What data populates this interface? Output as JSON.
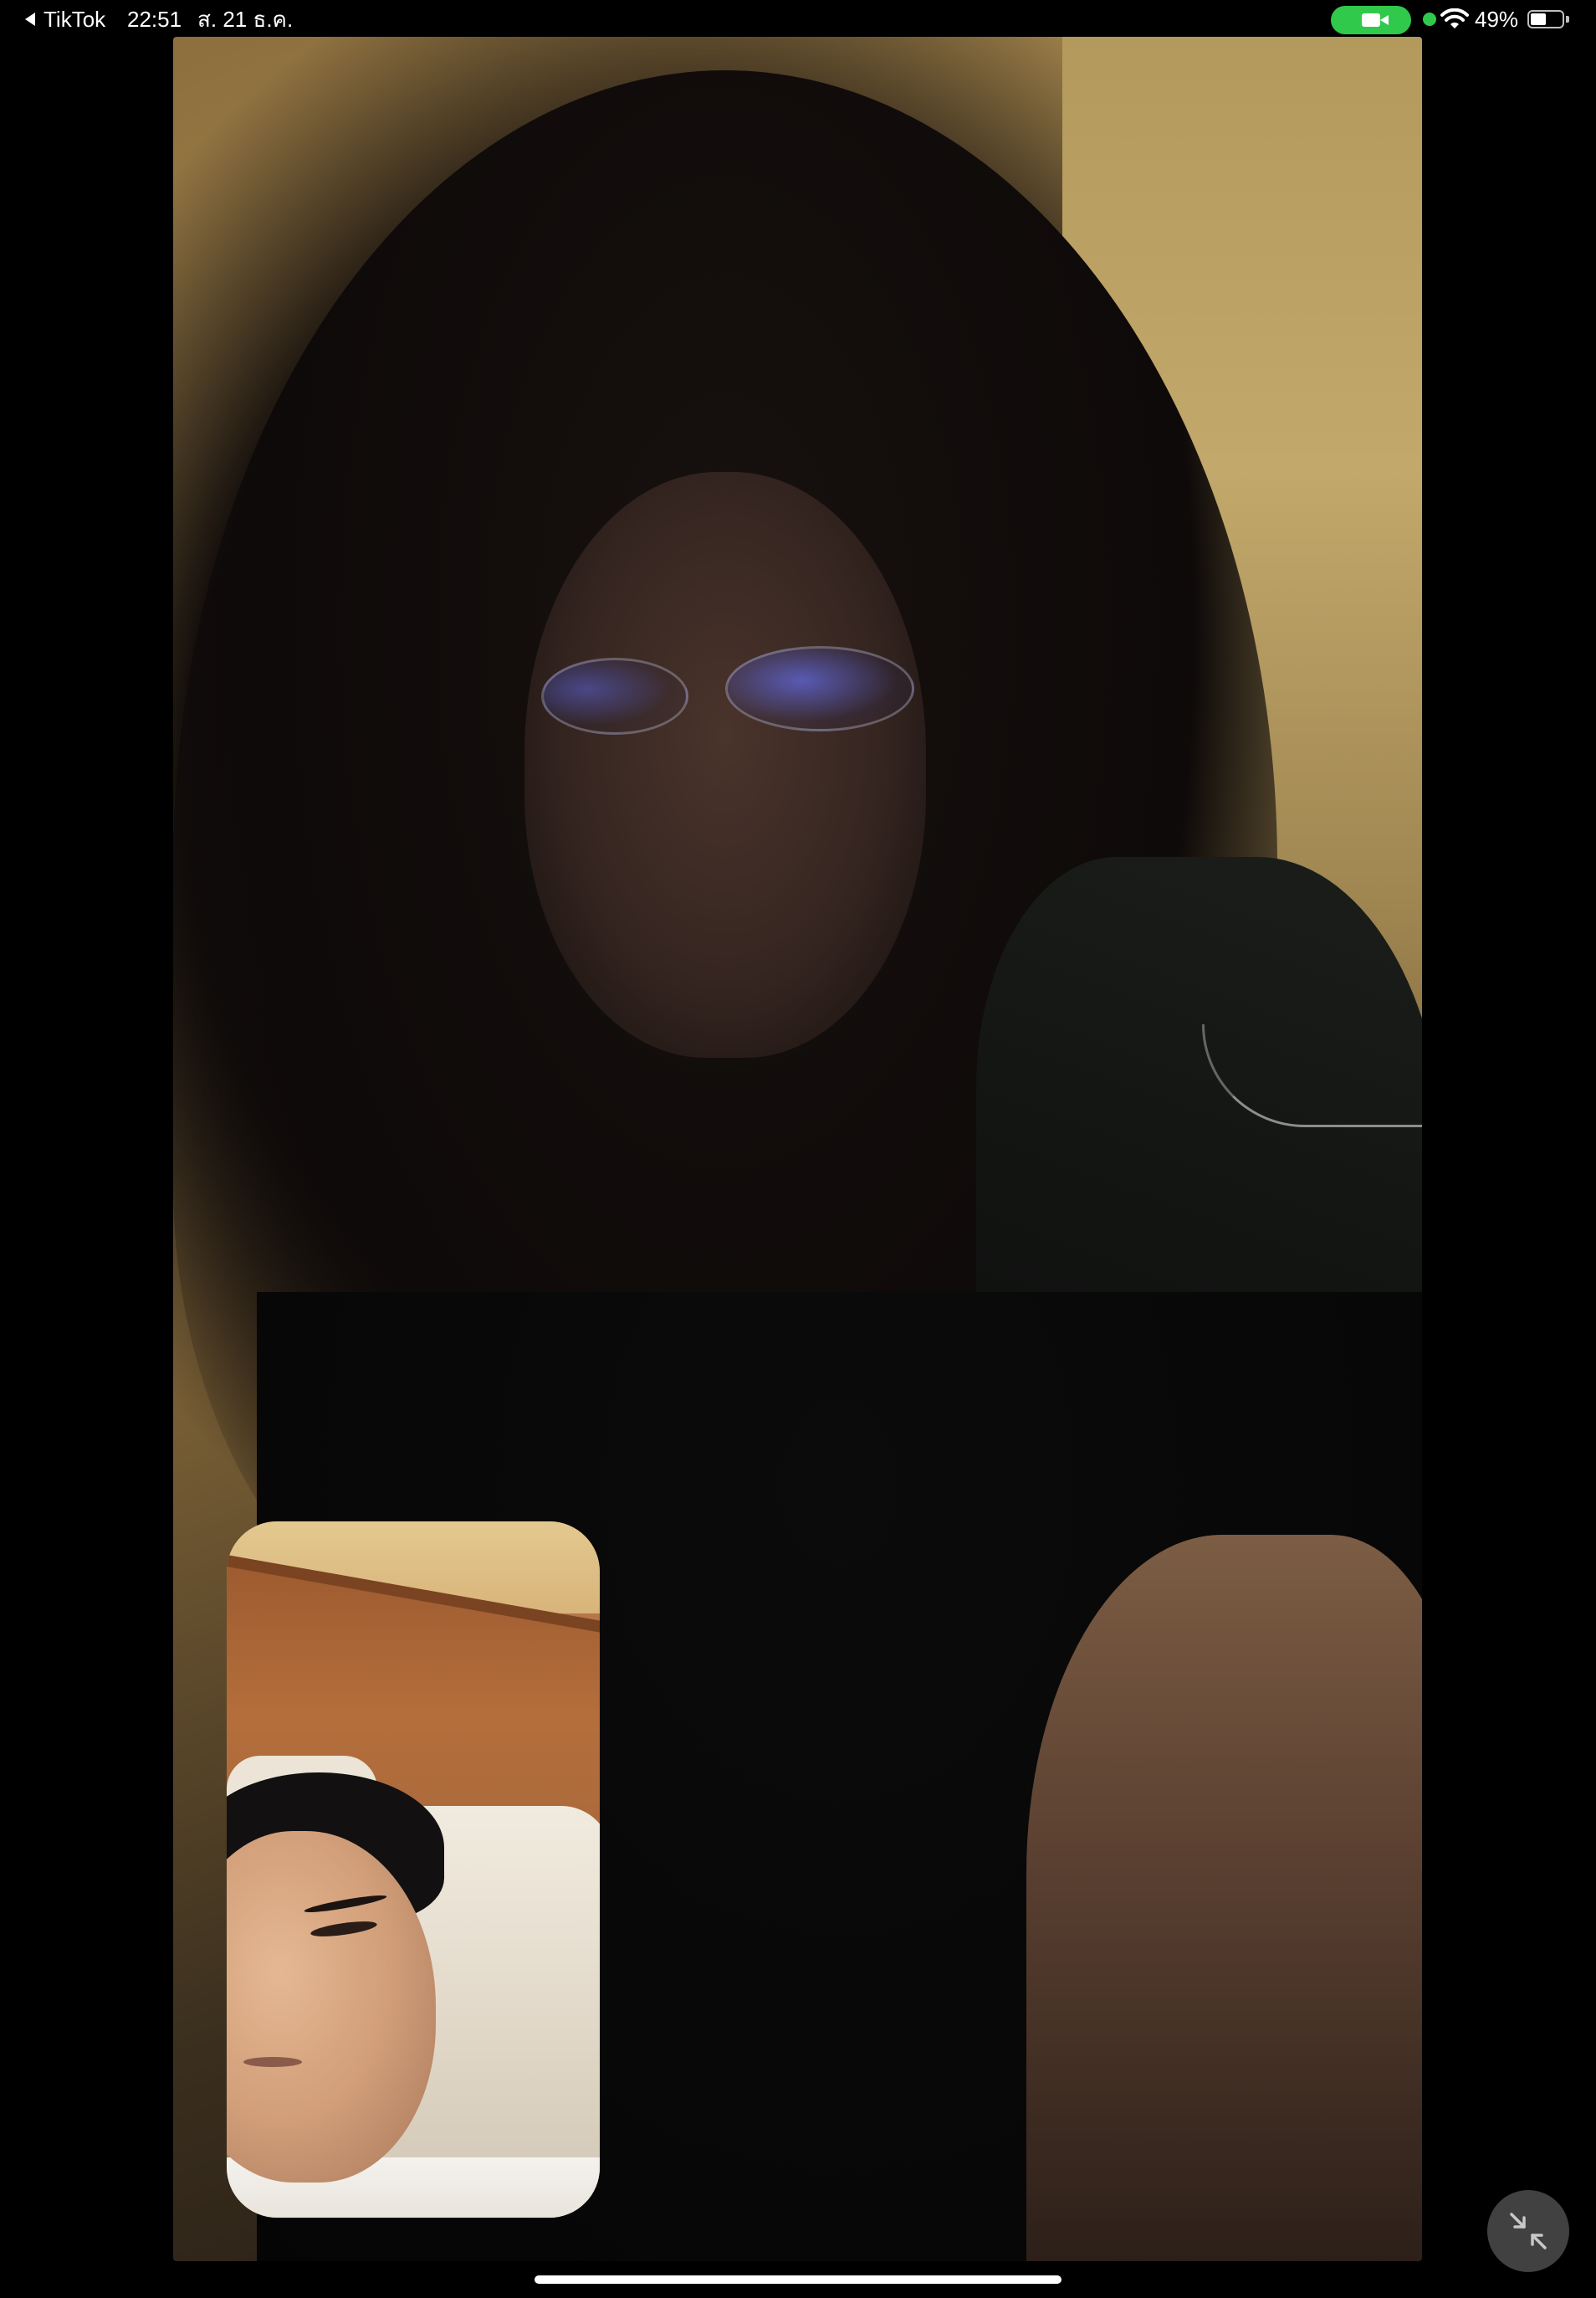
{
  "status_bar": {
    "back_app_label": "TikTok",
    "time": "22:51",
    "date": "ส. 21 ธ.ค.",
    "battery_percent_label": "49%",
    "battery_level": 0.49,
    "camera_active_color": "#30c94b",
    "icons": [
      "back-arrow-icon",
      "video-camera-icon",
      "camera-in-use-dot-icon",
      "wifi-icon",
      "battery-icon"
    ]
  },
  "call": {
    "remote_video": "remote-participant-video",
    "self_view": "self-camera-preview",
    "minimize_icon": "collapse-arrows-icon"
  }
}
